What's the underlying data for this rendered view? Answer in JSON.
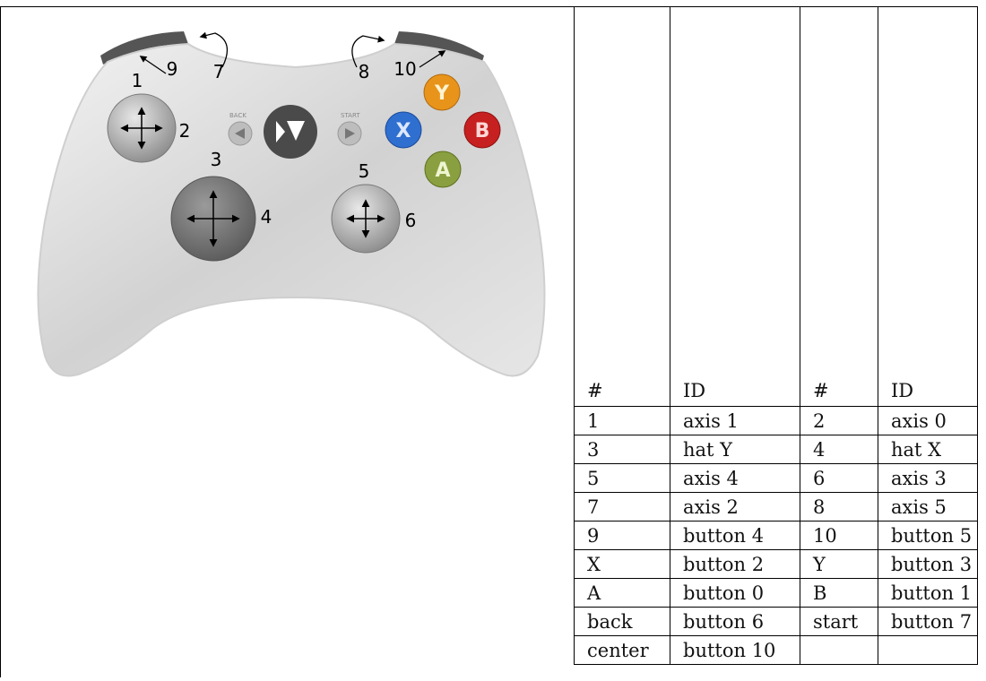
{
  "figure": {
    "labels": [
      "1",
      "2",
      "3",
      "4",
      "5",
      "6",
      "7",
      "8",
      "9",
      "10"
    ],
    "button_letters": {
      "y": "Y",
      "b": "B",
      "x": "X",
      "a": "A"
    },
    "small_labels": {
      "back": "BACK",
      "start": "START"
    },
    "colors": {
      "y": "#e8941a",
      "b": "#c62020",
      "x": "#2f6fd0",
      "a": "#8aa040",
      "body": "#dcdcdc",
      "dark": "#555555"
    }
  },
  "table": {
    "headers": [
      "#",
      "ID",
      "#",
      "ID"
    ],
    "rows": [
      [
        "1",
        "axis 1",
        "2",
        "axis 0"
      ],
      [
        "3",
        "hat Y",
        "4",
        "hat X"
      ],
      [
        "5",
        "axis 4",
        "6",
        "axis 3"
      ],
      [
        "7",
        "axis 2",
        "8",
        "axis 5"
      ],
      [
        "9",
        "button 4",
        "10",
        "button 5"
      ],
      [
        "X",
        "button 2",
        "Y",
        "button 3"
      ],
      [
        "A",
        "button 0",
        "B",
        "button 1"
      ],
      [
        "back",
        "button 6",
        "start",
        "button 7"
      ],
      [
        "center",
        "button 10",
        "",
        ""
      ]
    ]
  }
}
